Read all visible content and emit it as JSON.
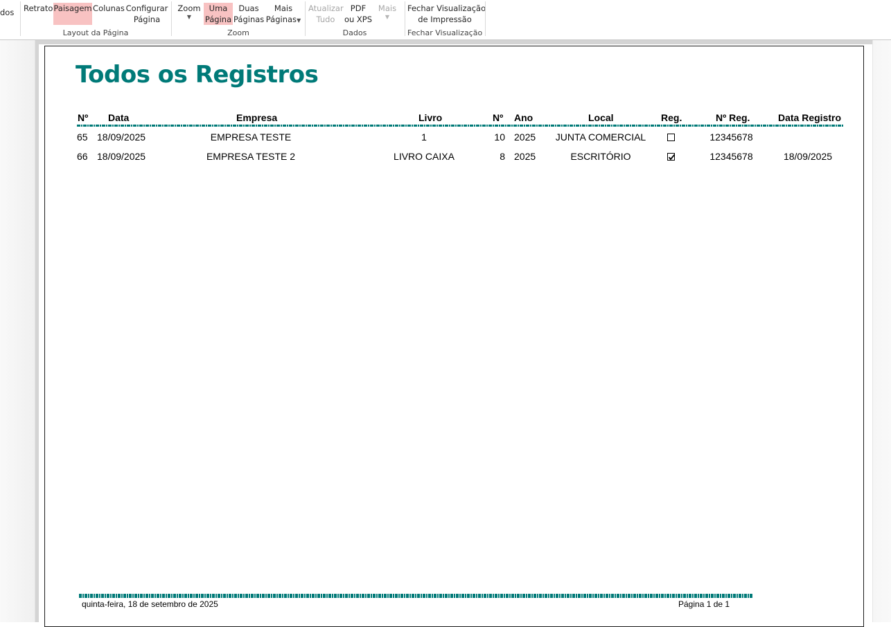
{
  "ribbon": {
    "cut_left_label": "dos",
    "layout": {
      "retrato": "Retrato",
      "paisagem": "Paisagem",
      "colunas": "Colunas",
      "configurar_line1": "Configurar",
      "configurar_line2": "Página",
      "group_label": "Layout da Página"
    },
    "zoom": {
      "zoom": "Zoom",
      "uma_line1": "Uma",
      "uma_line2": "Página",
      "duas_line1": "Duas",
      "duas_line2": "Páginas",
      "mais_line1": "Mais",
      "mais_line2": "Páginas",
      "group_label": "Zoom"
    },
    "dados": {
      "atualizar_line1": "Atualizar",
      "atualizar_line2": "Tudo",
      "pdf_line1": "PDF",
      "pdf_line2": "ou XPS",
      "mais": "Mais",
      "group_label": "Dados"
    },
    "fechar": {
      "line1": "Fechar Visualização",
      "line2": "de Impressão",
      "group_label": "Fechar Visualização"
    }
  },
  "report": {
    "title": "Todos os Registros",
    "columns": {
      "num": "Nº",
      "data": "Data",
      "empresa": "Empresa",
      "livro": "Livro",
      "num2": "Nº",
      "ano": "Ano",
      "local": "Local",
      "reg": "Reg.",
      "num_reg": "Nº Reg.",
      "data_registro": "Data Registro"
    },
    "rows": [
      {
        "num": "65",
        "data": "18/09/2025",
        "empresa": "EMPRESA TESTE",
        "livro": "1",
        "num2": "10",
        "ano": "2025",
        "local": "JUNTA COMERCIAL",
        "reg": false,
        "num_reg": "12345678",
        "data_registro": ""
      },
      {
        "num": "66",
        "data": "18/09/2025",
        "empresa": "EMPRESA TESTE 2",
        "livro": "LIVRO CAIXA",
        "num2": "8",
        "ano": "2025",
        "local": "ESCRITÓRIO",
        "reg": true,
        "num_reg": "12345678",
        "data_registro": "18/09/2025"
      }
    ],
    "footer": {
      "date": "quinta-feira, 18 de setembro de 2025",
      "page": "Página 1 de 1"
    }
  },
  "colors": {
    "accent": "#007a78",
    "highlight": "#f8c2c2"
  }
}
